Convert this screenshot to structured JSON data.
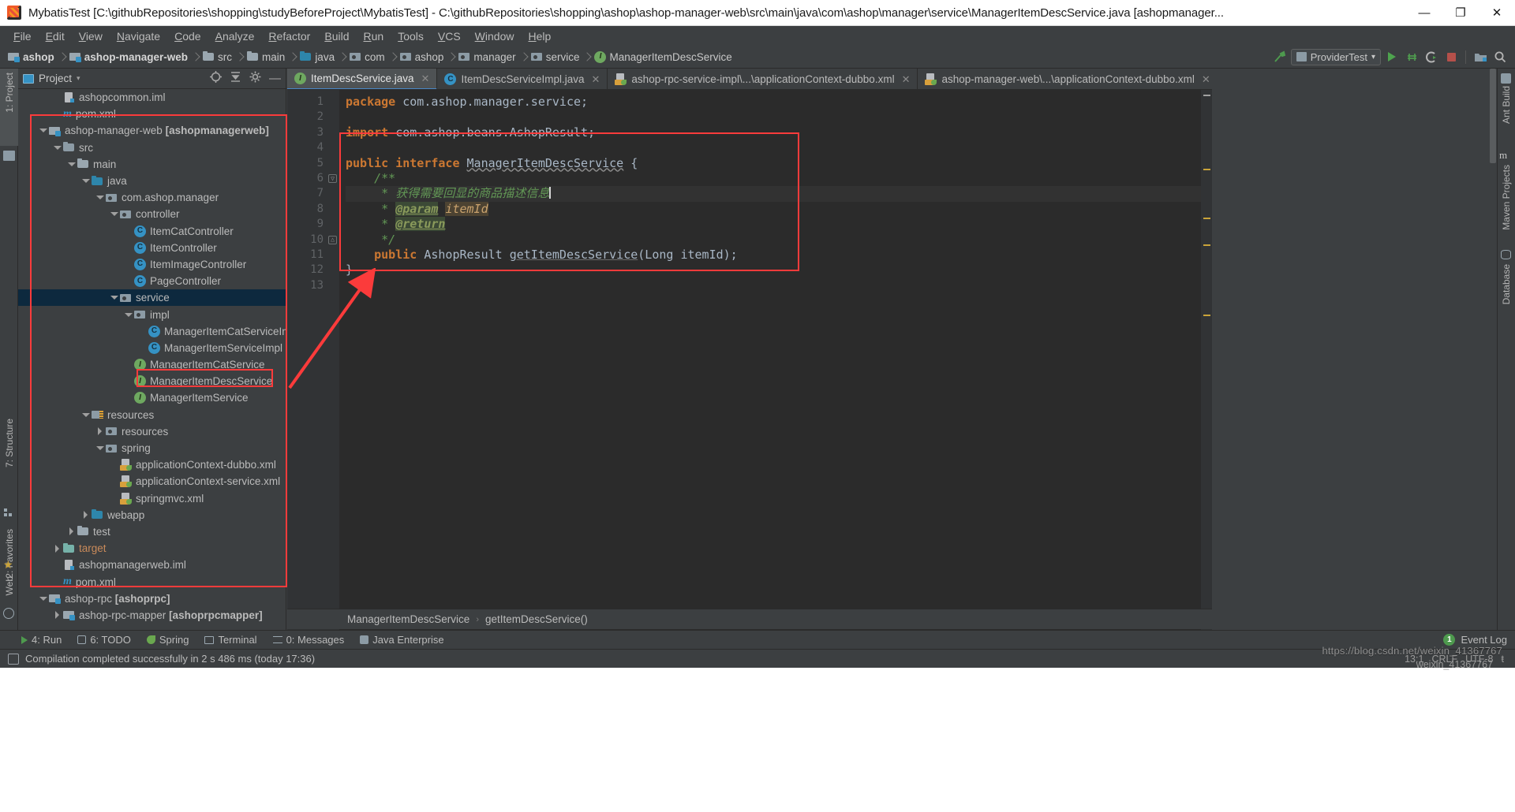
{
  "window": {
    "title": "MybatisTest [C:\\githubRepositories\\shopping\\studyBeforeProject\\MybatisTest] - C:\\githubRepositories\\shopping\\ashop\\ashop-manager-web\\src\\main\\java\\com\\ashop\\manager\\service\\ManagerItemDescService.java [ashopmanager...",
    "minimize": "—",
    "maximize": "❐",
    "close": "✕"
  },
  "menu": [
    "File",
    "Edit",
    "View",
    "Navigate",
    "Code",
    "Analyze",
    "Refactor",
    "Build",
    "Run",
    "Tools",
    "VCS",
    "Window",
    "Help"
  ],
  "breadcrumbs": [
    {
      "label": "ashop",
      "icon": "module-icon",
      "bold": true
    },
    {
      "label": "ashop-manager-web",
      "icon": "module-icon",
      "bold": true
    },
    {
      "label": "src",
      "icon": "folder-icon",
      "bold": false
    },
    {
      "label": "main",
      "icon": "folder-icon",
      "bold": false
    },
    {
      "label": "java",
      "icon": "source-folder-icon",
      "bold": false
    },
    {
      "label": "com",
      "icon": "package-icon",
      "bold": false
    },
    {
      "label": "ashop",
      "icon": "package-icon",
      "bold": false
    },
    {
      "label": "manager",
      "icon": "package-icon",
      "bold": false
    },
    {
      "label": "service",
      "icon": "package-icon",
      "bold": false
    },
    {
      "label": "ManagerItemDescService",
      "icon": "interface-icon",
      "bold": false
    }
  ],
  "toolbar_right": {
    "run_config": "ProviderTest",
    "run_config_caret": "▾"
  },
  "left_rail": [
    {
      "label": "1: Project",
      "selected": true
    },
    {
      "label": "7: Structure",
      "selected": false
    },
    {
      "label": "2: Favorites",
      "selected": false
    },
    {
      "label": "Web",
      "selected": false
    }
  ],
  "right_rail": [
    {
      "label": "Ant Build"
    },
    {
      "label": "Maven Projects"
    },
    {
      "label": "Database"
    }
  ],
  "project_panel": {
    "title": "Project",
    "caret": "▾",
    "tree": [
      {
        "indent": 2,
        "arrow": "none",
        "icon": "iml-icon",
        "label": "ashopcommon.iml",
        "bold": false
      },
      {
        "indent": 2,
        "arrow": "none",
        "icon": "pom-icon",
        "label": "pom.xml",
        "bold": false
      },
      {
        "indent": 1,
        "arrow": "down",
        "icon": "module-icon",
        "label": "ashop-manager-web ",
        "bold_suffix": "[ashopmanagerweb]"
      },
      {
        "indent": 2,
        "arrow": "down",
        "icon": "src-folder-icon",
        "label": "src",
        "bold": false
      },
      {
        "indent": 3,
        "arrow": "down",
        "icon": "folder-icon",
        "label": "main",
        "bold": false
      },
      {
        "indent": 4,
        "arrow": "down",
        "icon": "source-folder-icon",
        "label": "java",
        "bold": false
      },
      {
        "indent": 5,
        "arrow": "down",
        "icon": "package-icon",
        "label": "com.ashop.manager",
        "bold": false
      },
      {
        "indent": 6,
        "arrow": "down",
        "icon": "package-icon",
        "label": "controller",
        "bold": false
      },
      {
        "indent": 7,
        "arrow": "none",
        "icon": "class-icon",
        "label": "ItemCatController",
        "bold": false
      },
      {
        "indent": 7,
        "arrow": "none",
        "icon": "class-icon",
        "label": "ItemController",
        "bold": false
      },
      {
        "indent": 7,
        "arrow": "none",
        "icon": "class-icon",
        "label": "ItemImageController",
        "bold": false
      },
      {
        "indent": 7,
        "arrow": "none",
        "icon": "class-icon",
        "label": "PageController",
        "bold": false
      },
      {
        "indent": 6,
        "arrow": "down",
        "icon": "package-icon",
        "label": "service",
        "bold": false,
        "selected": true
      },
      {
        "indent": 7,
        "arrow": "down",
        "icon": "package-icon",
        "label": "impl",
        "bold": false
      },
      {
        "indent": 8,
        "arrow": "none",
        "icon": "class-icon",
        "label": "ManagerItemCatServiceImpl",
        "bold": false
      },
      {
        "indent": 8,
        "arrow": "none",
        "icon": "class-icon",
        "label": "ManagerItemServiceImpl",
        "bold": false
      },
      {
        "indent": 7,
        "arrow": "none",
        "icon": "interface-icon",
        "label": "ManagerItemCatService",
        "bold": false
      },
      {
        "indent": 7,
        "arrow": "none",
        "icon": "interface-icon",
        "label": "ManagerItemDescService",
        "bold": false,
        "annotated": true
      },
      {
        "indent": 7,
        "arrow": "none",
        "icon": "interface-icon",
        "label": "ManagerItemService",
        "bold": false
      },
      {
        "indent": 4,
        "arrow": "down",
        "icon": "resources-icon",
        "label": "resources",
        "bold": false
      },
      {
        "indent": 5,
        "arrow": "right",
        "icon": "package-icon",
        "label": "resources",
        "bold": false
      },
      {
        "indent": 5,
        "arrow": "down",
        "icon": "package-icon",
        "label": "spring",
        "bold": false
      },
      {
        "indent": 6,
        "arrow": "none",
        "icon": "spring-xml-icon",
        "label": "applicationContext-dubbo.xml",
        "bold": false
      },
      {
        "indent": 6,
        "arrow": "none",
        "icon": "spring-xml-icon",
        "label": "applicationContext-service.xml",
        "bold": false
      },
      {
        "indent": 6,
        "arrow": "none",
        "icon": "spring-xml-icon",
        "label": "springmvc.xml",
        "bold": false
      },
      {
        "indent": 4,
        "arrow": "right",
        "icon": "source-folder-icon",
        "label": "webapp",
        "bold": false
      },
      {
        "indent": 3,
        "arrow": "right",
        "icon": "folder-icon",
        "label": "test",
        "bold": false
      },
      {
        "indent": 2,
        "arrow": "right",
        "icon": "target-folder-icon",
        "label": "target",
        "bold": false,
        "target": true
      },
      {
        "indent": 2,
        "arrow": "none",
        "icon": "iml-icon",
        "label": "ashopmanagerweb.iml",
        "bold": false
      },
      {
        "indent": 2,
        "arrow": "none",
        "icon": "pom-icon",
        "label": "pom.xml",
        "bold": false
      },
      {
        "indent": 1,
        "arrow": "down",
        "icon": "module-icon",
        "label": "ashop-rpc ",
        "bold_suffix": "[ashoprpc]"
      },
      {
        "indent": 2,
        "arrow": "right",
        "icon": "module-icon",
        "label": "ashop-rpc-mapper ",
        "bold_suffix": "[ashoprpcmapper]"
      }
    ]
  },
  "editor": {
    "tabs": [
      {
        "label": "ItemDescService.java",
        "icon": "interface-icon",
        "active": true,
        "close": "✕"
      },
      {
        "label": "ItemDescServiceImpl.java",
        "icon": "class-icon",
        "active": false,
        "close": "✕"
      },
      {
        "label": "ashop-rpc-service-impl\\...\\applicationContext-dubbo.xml",
        "icon": "spring-xml-icon",
        "active": false,
        "close": "✕"
      },
      {
        "label": "ashop-manager-web\\...\\applicationContext-dubbo.xml",
        "icon": "spring-xml-icon",
        "active": false,
        "close": "✕"
      }
    ],
    "line_numbers": [
      "1",
      "2",
      "3",
      "4",
      "5",
      "6",
      "7",
      "8",
      "9",
      "10",
      "11",
      "12",
      "13"
    ],
    "code_lines": [
      {
        "n": 1,
        "tokens": [
          {
            "t": "package ",
            "c": "kw"
          },
          {
            "t": "com.ashop.manager.service;",
            "c": "plain"
          }
        ]
      },
      {
        "n": 2,
        "tokens": []
      },
      {
        "n": 3,
        "tokens": [
          {
            "t": "import ",
            "c": "kw"
          },
          {
            "t": "com.ashop.beans.AshopResult;",
            "c": "plain"
          }
        ]
      },
      {
        "n": 4,
        "tokens": []
      },
      {
        "n": 5,
        "tokens": [
          {
            "t": "public ",
            "c": "kw"
          },
          {
            "t": "interface ",
            "c": "kw"
          },
          {
            "t": "ManagerItemDescService",
            "c": "squig"
          },
          {
            "t": " {",
            "c": "plain"
          }
        ]
      },
      {
        "n": 6,
        "tokens": [
          {
            "t": "    /**",
            "c": "cmt"
          }
        ],
        "fold": true
      },
      {
        "n": 7,
        "tokens": [
          {
            "t": "     * ",
            "c": "cmt"
          },
          {
            "t": "获得需要回显的商品描述信息",
            "c": "cmt"
          },
          {
            "t": "|",
            "c": "caret"
          }
        ],
        "caretline": true
      },
      {
        "n": 8,
        "tokens": [
          {
            "t": "     * ",
            "c": "cmt"
          },
          {
            "t": "@param",
            "c": "tag"
          },
          {
            "t": " ",
            "c": "cmt"
          },
          {
            "t": "itemId",
            "c": "tagparam"
          }
        ]
      },
      {
        "n": 9,
        "tokens": [
          {
            "t": "     * ",
            "c": "cmt"
          },
          {
            "t": "@return",
            "c": "tag"
          }
        ]
      },
      {
        "n": 10,
        "tokens": [
          {
            "t": "     */",
            "c": "cmt"
          }
        ],
        "fold": true
      },
      {
        "n": 11,
        "tokens": [
          {
            "t": "    public ",
            "c": "kw"
          },
          {
            "t": "AshopResult ",
            "c": "plain"
          },
          {
            "t": "getItemDescService",
            "c": "und"
          },
          {
            "t": "(Long itemId);",
            "c": "plain"
          }
        ]
      },
      {
        "n": 12,
        "tokens": [
          {
            "t": "}",
            "c": "plain"
          }
        ]
      },
      {
        "n": 13,
        "tokens": []
      }
    ],
    "breadcrumb_footer": [
      "ManagerItemDescService",
      "getItemDescService()"
    ],
    "breadcrumb_sep": "›"
  },
  "bottom_bar": {
    "items": [
      {
        "label": "4: Run",
        "icon": "run-icon"
      },
      {
        "label": "6: TODO",
        "icon": "todo-icon"
      },
      {
        "label": "Spring",
        "icon": "spring-icon"
      },
      {
        "label": "Terminal",
        "icon": "terminal-icon"
      },
      {
        "label": "0: Messages",
        "icon": "messages-icon"
      },
      {
        "label": "Java Enterprise",
        "icon": "java-ee-icon"
      }
    ],
    "event_log": "Event Log",
    "event_count": "1"
  },
  "status_bar": {
    "message": "Compilation completed successfully in 2 s 486 ms (today 17:36)",
    "right": [
      "13:1",
      "CRLF",
      "UTF-8",
      "ŧ"
    ]
  },
  "watermark": {
    "url": "https://blog.csdn.net/weixin_41367767",
    "id": "weixin_41367767"
  },
  "colors": {
    "accent_red": "#fb3b3b",
    "selection_blue": "#0d293e",
    "editor_bg": "#2b2b2b",
    "panel_bg": "#3c3f41",
    "keyword_orange": "#cc7832",
    "comment_green": "#629755",
    "interface_green": "#6ea860",
    "class_blue": "#3592c4"
  }
}
